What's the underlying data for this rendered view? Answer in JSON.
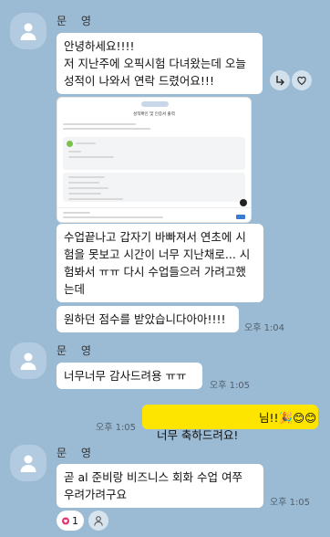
{
  "sender": {
    "name": "문 영"
  },
  "messages": {
    "m1": "안녕하세요!!!!\n저 지난주에 오픽시험 다녀왔는데 오늘\n성적이 나와서 연락 드렸어요!!!",
    "shot_title": "성적확인 및 인증서 출력",
    "m2": "수업끝나고 갑자기 바빠져서 연초에 시\n험을 못보고 시간이 너무 지난채로... 시\n험봐서 ㅠㅠ 다시 수업들으러 가려고했\n는데",
    "m3": "원하던 점수를 받았습니다아아!!!!",
    "t1": "오후 1:04",
    "m4": "너무너무 감사드려용 ㅠㅠ",
    "t2": "오후 1:05",
    "m5": "너무 축하드려요!",
    "m5_tail": "님!!🎉😊😊",
    "t3": "오후 1:05",
    "m6": "곧 al 준비랑 비즈니스 회화 수업 여쭈\n우려가려구요",
    "t4": "오후 1:05",
    "reaction_count": "1"
  },
  "icons": {
    "avatar": "person-icon",
    "share": "share-icon",
    "like": "heart-icon",
    "reaction": "heart-icon",
    "profile": "person-icon"
  },
  "colors": {
    "background": "#9bbbd4",
    "my_bubble": "#fee500",
    "heart": "#e8336d"
  }
}
